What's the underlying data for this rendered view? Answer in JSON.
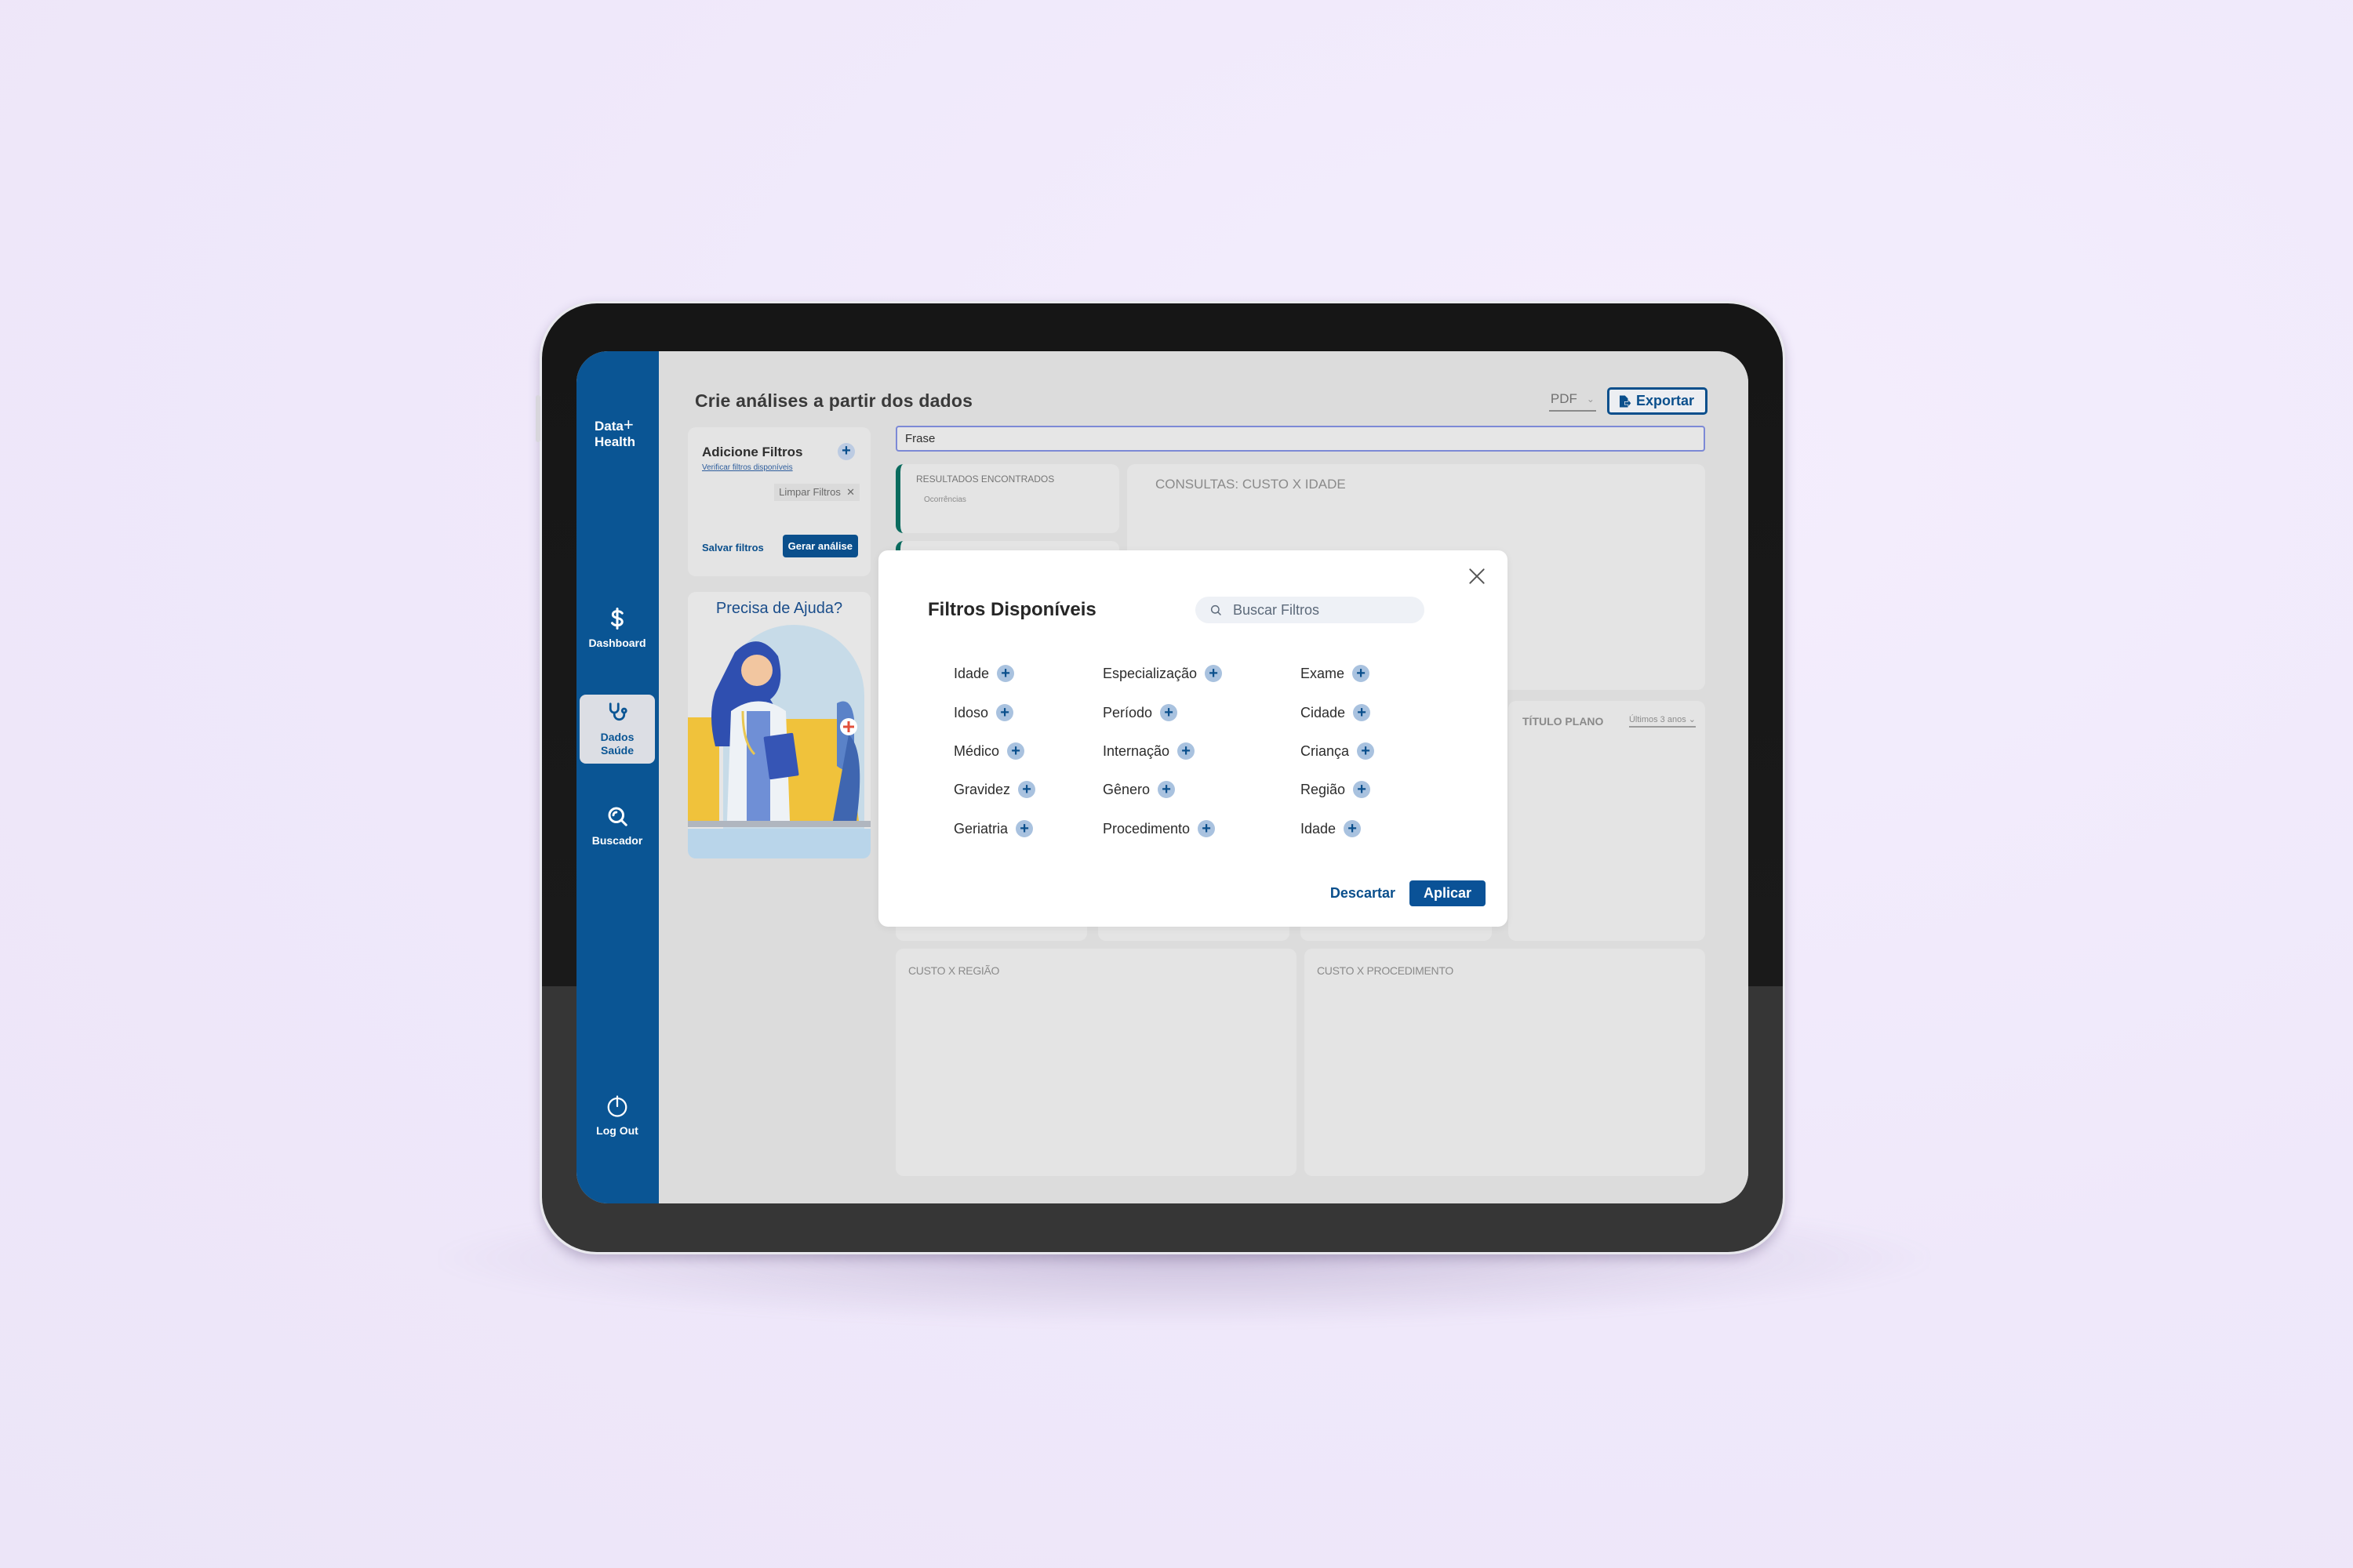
{
  "app": {
    "brand_line1": "Data",
    "brand_line2": "Health",
    "accent_color": "#0a5594"
  },
  "sidebar": {
    "items": [
      {
        "label": "Dashboard",
        "icon": "dollar-icon",
        "active": false
      },
      {
        "label_line1": "Dados",
        "label_line2": "Saúde",
        "icon": "stethoscope-icon",
        "active": true
      },
      {
        "label": "Buscador",
        "icon": "search-icon",
        "active": false
      },
      {
        "label": "Log Out",
        "icon": "power-icon",
        "active": false
      }
    ]
  },
  "header": {
    "title": "Crie análises a partir dos dados",
    "format_select": "PDF",
    "export_label": "Exportar"
  },
  "filters_panel": {
    "title": "Adicione Filtros",
    "link": "Verificar filtros disponíveis",
    "clear_label": "Limpar Filtros",
    "save_label": "Salvar filtros",
    "generate_label": "Gerar análise"
  },
  "help": {
    "title": "Precisa de Ajuda?"
  },
  "search": {
    "value": "Frase"
  },
  "cards": {
    "results_title": "RESULTADOS ENCONTRADOS",
    "results_sub": "Ocorrências",
    "consultas_title": "CONSULTAS: CUSTO X IDADE",
    "plano_title": "TÍTULO PLANO",
    "plano_period": "Últimos 3 anos",
    "regiao_title": "CUSTO X REGIÃO",
    "procedimento_title": "CUSTO X PROCEDIMENTO"
  },
  "modal": {
    "title": "Filtros Disponíveis",
    "search_placeholder": "Buscar Filtros",
    "columns": [
      [
        "Idade",
        "Idoso",
        "Médico",
        "Gravidez",
        "Geriatria"
      ],
      [
        "Especialização",
        "Período",
        "Internação",
        "Gênero",
        "Procedimento"
      ],
      [
        "Exame",
        "Cidade",
        "Criança",
        "Região",
        "Idade"
      ]
    ],
    "discard_label": "Descartar",
    "apply_label": "Aplicar"
  }
}
